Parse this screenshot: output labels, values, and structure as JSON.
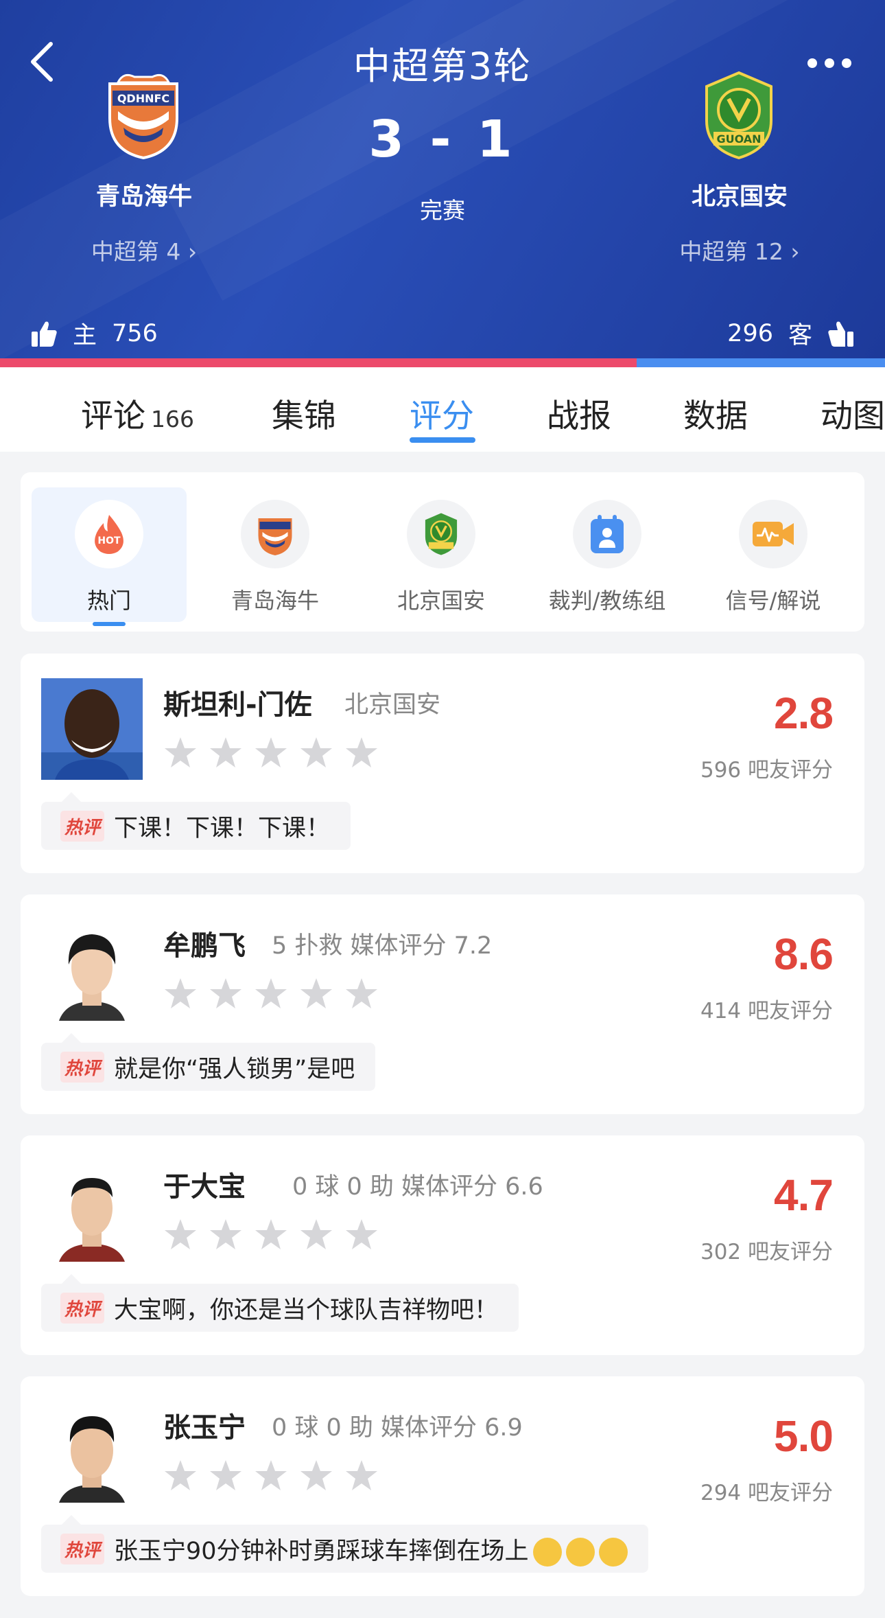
{
  "header": {
    "round_title": "中超第3轮",
    "score": "3 - 1",
    "status": "完赛",
    "home": {
      "name": "青岛海牛",
      "rank": "中超第 4 ›",
      "logo": "qingdao-hainiu-logo"
    },
    "away": {
      "name": "北京国安",
      "rank": "中超第 12 ›",
      "logo": "beijing-guoan-logo"
    }
  },
  "support": {
    "home_label": "主",
    "home_count": "756",
    "away_label": "客",
    "away_count": "296",
    "home_fraction": 0.719,
    "colors": {
      "home": "#ec4a6b",
      "away": "#4a8ef0"
    }
  },
  "tabs": [
    {
      "label": "评论",
      "count": "166"
    },
    {
      "label": "集锦"
    },
    {
      "label": "评分",
      "active": true
    },
    {
      "label": "战报"
    },
    {
      "label": "数据"
    },
    {
      "label": "动图"
    }
  ],
  "filters": [
    {
      "label": "热门",
      "icon": "hot-icon",
      "active": true
    },
    {
      "label": "青岛海牛",
      "icon": "qingdao-logo-icon"
    },
    {
      "label": "北京国安",
      "icon": "guoan-logo-icon"
    },
    {
      "label": "裁判/教练组",
      "icon": "referee-icon"
    },
    {
      "label": "信号/解说",
      "icon": "broadcast-icon"
    }
  ],
  "hot_tag": "热评",
  "players": [
    {
      "name": "斯坦利-门佐",
      "info": "北京国安",
      "score": "2.8",
      "votes": "596 吧友评分",
      "comment": "下课！下课！下课！",
      "stars_filled": 0
    },
    {
      "name": "牟鹏飞",
      "info": "5 扑救   媒体评分 7.2",
      "score": "8.6",
      "votes": "414 吧友评分",
      "comment": "就是你“强人锁男”是吧",
      "stars_filled": 0
    },
    {
      "name": "于大宝",
      "info": "0 球  0 助   媒体评分 6.6",
      "score": "4.7",
      "votes": "302 吧友评分",
      "comment": "大宝啊，你还是当个球队吉祥物吧！",
      "stars_filled": 0
    },
    {
      "name": "张玉宁",
      "info": "0 球  0 助   媒体评分 6.9",
      "score": "5.0",
      "votes": "294 吧友评分",
      "comment": "张玉宁90分钟补时勇踩球车摔倒在场上",
      "emoji": "laughing-emoji",
      "stars_filled": 0
    }
  ]
}
